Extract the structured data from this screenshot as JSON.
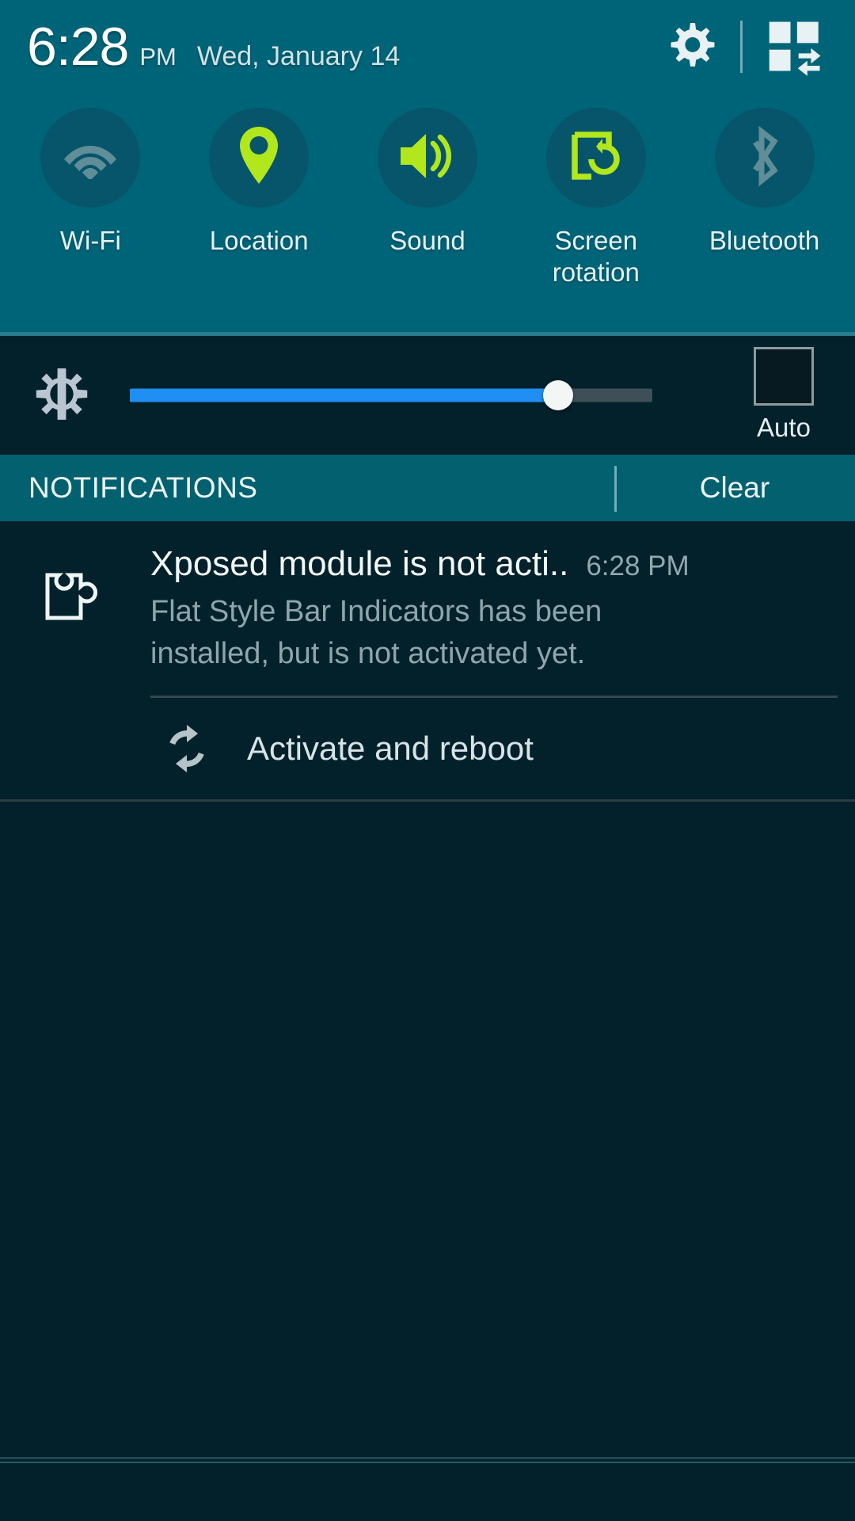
{
  "statusbar": {
    "time": "6:28",
    "ampm": "PM",
    "date": "Wed, January 14",
    "settings_icon": "gear-icon",
    "quick_settings_icon": "quick-settings-grid-icon"
  },
  "quick_toggles": [
    {
      "label": "Wi-Fi",
      "icon": "wifi-icon",
      "state": "off",
      "color": "#6f9ba6"
    },
    {
      "label": "Location",
      "icon": "location-pin-icon",
      "state": "on",
      "color": "#b2e61d"
    },
    {
      "label": "Sound",
      "icon": "sound-speaker-icon",
      "state": "on",
      "color": "#b2e61d"
    },
    {
      "label": "Screen\nrotation",
      "label_line1": "Screen",
      "label_line2": "rotation",
      "icon": "screen-rotation-icon",
      "state": "on",
      "color": "#b2e61d"
    },
    {
      "label": "Bluetooth",
      "icon": "bluetooth-icon",
      "state": "off",
      "color": "#6f9ba6"
    }
  ],
  "brightness": {
    "icon": "brightness-sun-icon",
    "value_percent": 82,
    "fill_color": "#1f8ff4",
    "track_color": "#3e4f57",
    "auto_label": "Auto",
    "auto_checked": false
  },
  "notifications_header": {
    "title": "NOTIFICATIONS",
    "clear_label": "Clear"
  },
  "notification": {
    "icon": "xposed-puzzle-piece-icon",
    "title": "Xposed module is not acti..",
    "time": "6:28 PM",
    "text": "Flat Style Bar Indicators has been installed, but is not activated yet.",
    "action": {
      "icon": "refresh-sync-icon",
      "label": "Activate and reboot"
    }
  },
  "theme": {
    "panel_teal": "#006478",
    "notif_header_teal": "#03616f",
    "dark_background": "#03212b",
    "accent_green": "#b2e61d",
    "inactive_gray": "#6f9ba6"
  }
}
